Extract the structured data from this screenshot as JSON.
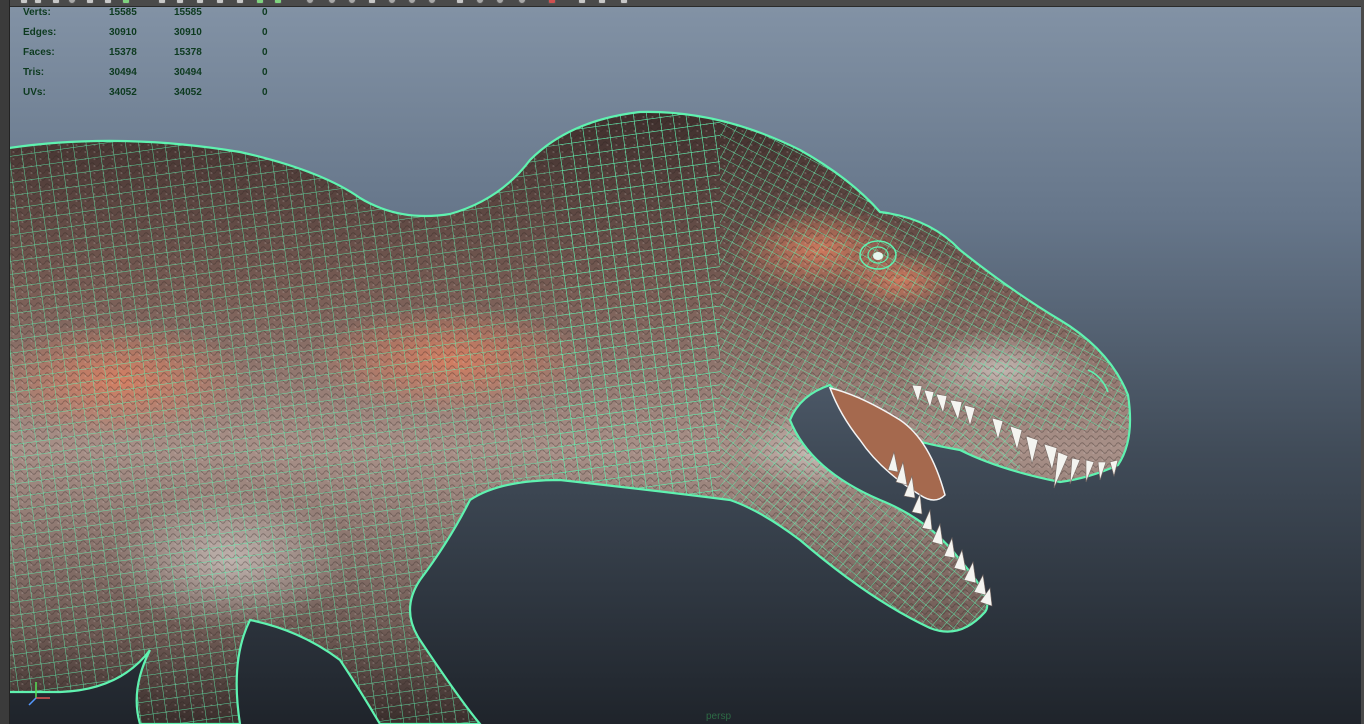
{
  "toolbar": {
    "icons": [
      "select-tool-icon",
      "lasso-icon",
      "paint-select-icon",
      "move-icon",
      "rotate-icon",
      "scale-icon",
      "snap-icon",
      "render-icon",
      "ipr-icon",
      "render-settings-icon",
      "hypershade-icon",
      "camera-icon",
      "light-icon",
      "shading-icon",
      "texture-icon",
      "undo-icon"
    ]
  },
  "hud": {
    "rows": [
      {
        "label": "Verts:",
        "a": "15585",
        "b": "15585",
        "c": "0"
      },
      {
        "label": "Edges:",
        "a": "30910",
        "b": "30910",
        "c": "0"
      },
      {
        "label": "Faces:",
        "a": "15378",
        "b": "15378",
        "c": "0"
      },
      {
        "label": "Tris:",
        "a": "30494",
        "b": "30494",
        "c": "0"
      },
      {
        "label": "UVs:",
        "a": "34052",
        "b": "34052",
        "c": "0"
      }
    ]
  },
  "viewport": {
    "camera": "persp"
  },
  "colors": {
    "wireframe": "#5ff2b0",
    "hud_text": "#0d3a1f",
    "skin_light": "#b8a59a",
    "skin_dark": "#4a3330",
    "skin_orange": "#d47a5c",
    "teeth": "#f4f4f0"
  }
}
